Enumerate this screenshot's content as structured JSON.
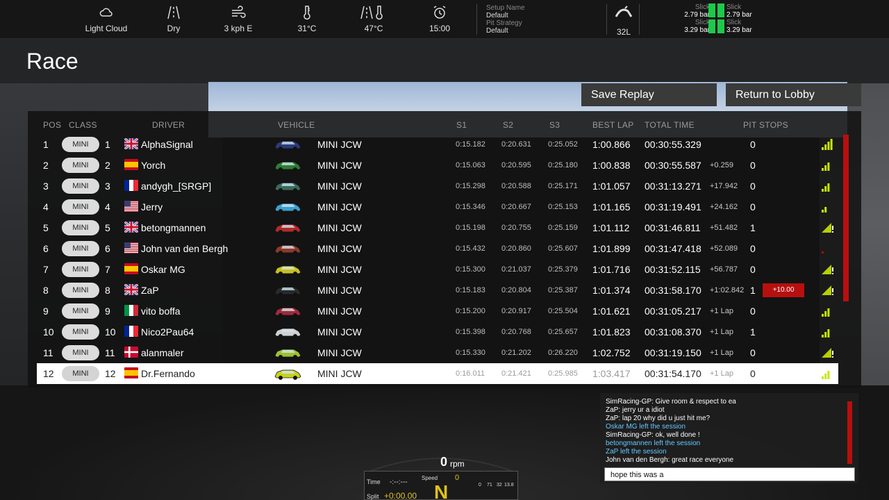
{
  "conditions": {
    "weather": "Light Cloud",
    "track": "Dry",
    "wind": "3 kph E",
    "air_temp": "31°C",
    "track_temp": "47°C",
    "time": "15:00"
  },
  "setup": {
    "setup_name_label": "Setup Name",
    "setup_name": "Default",
    "pit_strategy_label": "Pit Strategy",
    "pit_strategy": "Default"
  },
  "fuel": "32L",
  "tyres": {
    "fl_label": "Slick",
    "fl_pressure": "2.79 bar",
    "fr_label": "Slick",
    "fr_pressure": "2.79 bar",
    "rl_label": "Slick",
    "rl_pressure": "3.29 bar",
    "rr_label": "Slick",
    "rr_pressure": "3.29 bar"
  },
  "page_title": "Race",
  "buttons": {
    "save_replay": "Save Replay",
    "return_lobby": "Return to Lobby"
  },
  "columns": {
    "pos": "POS",
    "class": "CLASS",
    "driver": "DRIVER",
    "vehicle": "VEHICLE",
    "s1": "S1",
    "s2": "S2",
    "s3": "S3",
    "best_lap": "BEST LAP",
    "total_time": "TOTAL TIME",
    "pit_stops": "PIT STOPS"
  },
  "results": [
    {
      "pos": "1",
      "class": "MINI",
      "class_pos": "1",
      "flag": "gb",
      "driver": "AlphaSignal",
      "car_color": "#2b3a7a",
      "vehicle": "MINI JCW",
      "s1": "0:15.182",
      "s2": "0:20.631",
      "s3": "0:25.052",
      "best_lap": "1:00.866",
      "total": "00:30:55.329",
      "gap": "",
      "pits": "0",
      "penalty": "",
      "signal": 4
    },
    {
      "pos": "2",
      "class": "MINI",
      "class_pos": "2",
      "flag": "es",
      "driver": "Yorch",
      "car_color": "#2e7d32",
      "vehicle": "MINI JCW",
      "s1": "0:15.063",
      "s2": "0:20.595",
      "s3": "0:25.180",
      "best_lap": "1:00.838",
      "total": "00:30:55.587",
      "gap": "+0.259",
      "pits": "0",
      "penalty": "",
      "signal": 3
    },
    {
      "pos": "3",
      "class": "MINI",
      "class_pos": "3",
      "flag": "fr",
      "driver": "andygh_[SRGP]",
      "car_color": "#3a6a5a",
      "vehicle": "MINI JCW",
      "s1": "0:15.298",
      "s2": "0:20.588",
      "s3": "0:25.171",
      "best_lap": "1:01.057",
      "total": "00:31:13.271",
      "gap": "+17.942",
      "pits": "0",
      "penalty": "",
      "signal": 3
    },
    {
      "pos": "4",
      "class": "MINI",
      "class_pos": "4",
      "flag": "us",
      "driver": "Jerry",
      "car_color": "#3aa0d0",
      "vehicle": "MINI JCW",
      "s1": "0:15.346",
      "s2": "0:20.667",
      "s3": "0:25.153",
      "best_lap": "1:01.165",
      "total": "00:31:19.491",
      "gap": "+24.162",
      "pits": "0",
      "penalty": "",
      "signal": 2
    },
    {
      "pos": "5",
      "class": "MINI",
      "class_pos": "5",
      "flag": "gb",
      "driver": "betongmannen",
      "car_color": "#b02a2a",
      "vehicle": "MINI JCW",
      "s1": "0:15.198",
      "s2": "0:20.755",
      "s3": "0:25.159",
      "best_lap": "1:01.112",
      "total": "00:31:46.811",
      "gap": "+51.482",
      "pits": "1",
      "penalty": "",
      "signal": 5
    },
    {
      "pos": "6",
      "class": "MINI",
      "class_pos": "6",
      "flag": "us",
      "driver": "John van den Bergh",
      "car_color": "#8a3a2a",
      "vehicle": "MINI JCW",
      "s1": "0:15.432",
      "s2": "0:20.860",
      "s3": "0:25.607",
      "best_lap": "1:01.899",
      "total": "00:31:47.418",
      "gap": "+52.089",
      "pits": "0",
      "penalty": "",
      "signal": 1
    },
    {
      "pos": "7",
      "class": "MINI",
      "class_pos": "7",
      "flag": "es",
      "driver": "Oskar MG",
      "car_color": "#c8c020",
      "vehicle": "MINI JCW",
      "s1": "0:15.300",
      "s2": "0:21.037",
      "s3": "0:25.379",
      "best_lap": "1:01.716",
      "total": "00:31:52.115",
      "gap": "+56.787",
      "pits": "0",
      "penalty": "",
      "signal": 5
    },
    {
      "pos": "8",
      "class": "MINI",
      "class_pos": "8",
      "flag": "gb",
      "driver": "ZaP",
      "car_color": "#2a2a2a",
      "vehicle": "MINI JCW",
      "s1": "0:15.183",
      "s2": "0:20.804",
      "s3": "0:25.387",
      "best_lap": "1:01.374",
      "total": "00:31:58.170",
      "gap": "+1:02.842",
      "pits": "1",
      "penalty": "+10.00",
      "signal": 5
    },
    {
      "pos": "9",
      "class": "MINI",
      "class_pos": "9",
      "flag": "it",
      "driver": "vito boffa",
      "car_color": "#a02a3a",
      "vehicle": "MINI JCW",
      "s1": "0:15.200",
      "s2": "0:20.917",
      "s3": "0:25.504",
      "best_lap": "1:01.621",
      "total": "00:31:05.217",
      "gap": "+1 Lap",
      "pits": "0",
      "penalty": "",
      "signal": 3
    },
    {
      "pos": "10",
      "class": "MINI",
      "class_pos": "10",
      "flag": "fr",
      "driver": "Nico2Pau64",
      "car_color": "#d0d0d0",
      "vehicle": "MINI JCW",
      "s1": "0:15.398",
      "s2": "0:20.768",
      "s3": "0:25.657",
      "best_lap": "1:01.823",
      "total": "00:31:08.370",
      "gap": "+1 Lap",
      "pits": "1",
      "penalty": "",
      "signal": 3
    },
    {
      "pos": "11",
      "class": "MINI",
      "class_pos": "11",
      "flag": "dk",
      "driver": "alanmaler",
      "car_color": "#a0c030",
      "vehicle": "MINI JCW",
      "s1": "0:15.330",
      "s2": "0:21.202",
      "s3": "0:26.220",
      "best_lap": "1:02.752",
      "total": "00:31:19.150",
      "gap": "+1 Lap",
      "pits": "0",
      "penalty": "",
      "signal": 5
    },
    {
      "pos": "12",
      "class": "MINI",
      "class_pos": "12",
      "flag": "es",
      "driver": "Dr.Fernando",
      "car_color": "#c8d020",
      "vehicle": "MINI JCW",
      "s1": "0:16.011",
      "s2": "0:21.421",
      "s3": "0:25.985",
      "best_lap": "1:03.417",
      "total": "00:31:54.170",
      "gap": "+1 Lap",
      "pits": "0",
      "penalty": "",
      "signal": 3,
      "selected": true
    }
  ],
  "chat": [
    {
      "text": "SimRacing-GP: Give room & respect to ea",
      "type": "usr"
    },
    {
      "text": "ZaP: jerry ur a idiot",
      "type": "usr"
    },
    {
      "text": "ZaP: lap 20 why did u just hit me?",
      "type": "usr"
    },
    {
      "text": "Oskar MG left the session",
      "type": "sys"
    },
    {
      "text": "SimRacing-GP: ok, well done !",
      "type": "usr"
    },
    {
      "text": "betongmannen left the session",
      "type": "sys"
    },
    {
      "text": "ZaP left the session",
      "type": "sys"
    },
    {
      "text": "John van den Bergh: great race everyone",
      "type": "usr"
    }
  ],
  "chat_input": "hope this was a",
  "dashboard": {
    "rpm": "0",
    "rpm_unit": "rpm",
    "time_label": "Time",
    "time_value": "-:--:---",
    "split_label": "Split",
    "split_value": "+0:00.00",
    "speed_label": "Speed",
    "speed_value": "0",
    "gear": "N",
    "fuel_small": "32",
    "val_71": "71",
    "val_138": "13.8",
    "val_0": "0"
  },
  "colors": {
    "accent_red": "#b80f0f",
    "signal_green": "#c8e600",
    "tyre_green": "#1ec94a",
    "chat_system": "#64c8ff"
  }
}
